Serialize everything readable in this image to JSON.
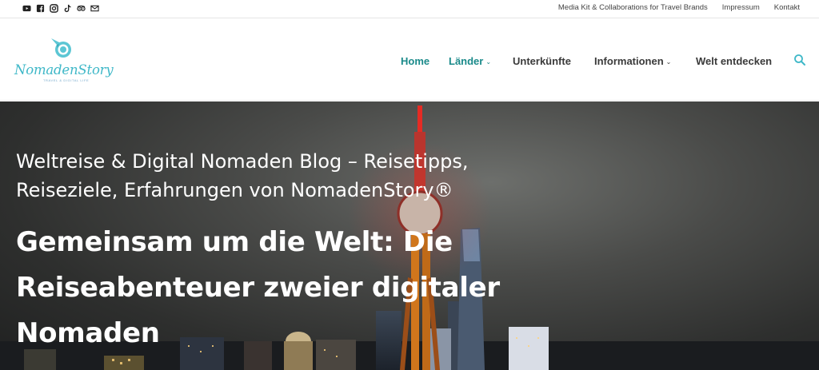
{
  "topbar": {
    "socials": [
      {
        "icon": "youtube-icon"
      },
      {
        "icon": "facebook-icon"
      },
      {
        "icon": "instagram-icon"
      },
      {
        "icon": "tiktok-icon"
      },
      {
        "icon": "tripadvisor-icon"
      },
      {
        "icon": "mail-icon"
      }
    ],
    "links": [
      "Media Kit & Collaborations for Travel Brands",
      "Impressum",
      "Kontakt"
    ]
  },
  "header": {
    "logo_text": "NomadenStory",
    "logo_sub": "TRAVEL & DIGITAL LIFE",
    "nav": [
      {
        "label": "Home",
        "active": true
      },
      {
        "label": "Länder",
        "dropdown": true
      },
      {
        "label": "Unterkünfte"
      },
      {
        "label": "Informationen",
        "dropdown": true
      },
      {
        "label": "Welt entdecken"
      }
    ],
    "caret": "⌄"
  },
  "hero": {
    "subtitle": "Weltreise & Digital Nomaden Blog – Reisetipps, Reiseziele, Erfahrungen von NomadenStory®",
    "title": "Gemeinsam um die Welt: Die Reiseabenteuer zweier digitaler Nomaden"
  },
  "colors": {
    "accent": "#1a8a8a",
    "logo": "#3fb8c8",
    "nav_text": "#3a3a3a"
  }
}
